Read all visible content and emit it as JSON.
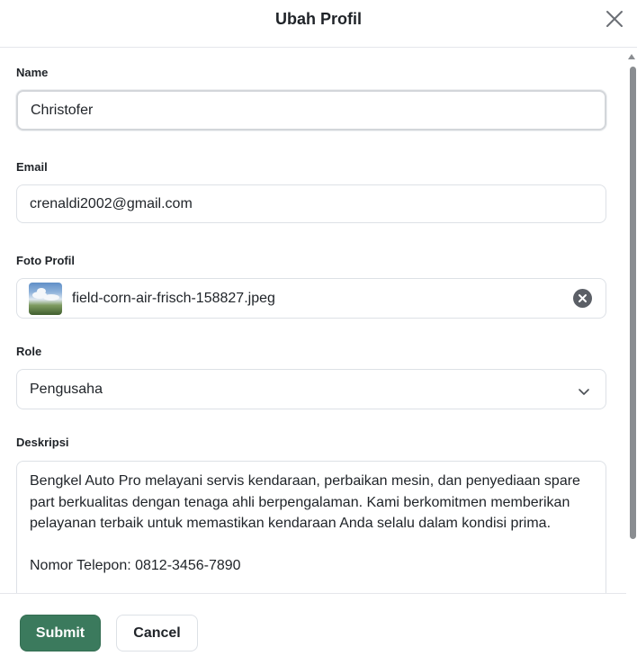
{
  "dialog": {
    "title": "Ubah Profil",
    "close_icon": "close-icon"
  },
  "form": {
    "name": {
      "label": "Name",
      "value": "Christofer"
    },
    "email": {
      "label": "Email",
      "value": "crenaldi2002@gmail.com"
    },
    "photo": {
      "label": "Foto Profil",
      "filename": "field-corn-air-frisch-158827.jpeg",
      "clear_icon": "clear-x-icon"
    },
    "role": {
      "label": "Role",
      "selected": "Pengusaha",
      "chevron_icon": "chevron-down-icon"
    },
    "description": {
      "label": "Deskripsi",
      "value": "Bengkel Auto Pro melayani servis kendaraan, perbaikan mesin, dan penyediaan spare part berkualitas dengan tenaga ahli berpengalaman. Kami berkomitmen memberikan pelayanan terbaik untuk memastikan kendaraan Anda selalu dalam kondisi prima.\n\nNomor Telepon: 0812-3456-7890"
    }
  },
  "footer": {
    "submit_label": "Submit",
    "cancel_label": "Cancel"
  },
  "colors": {
    "primary": "#3b7a5d",
    "border": "#dde1e6",
    "text": "#1f2328"
  }
}
